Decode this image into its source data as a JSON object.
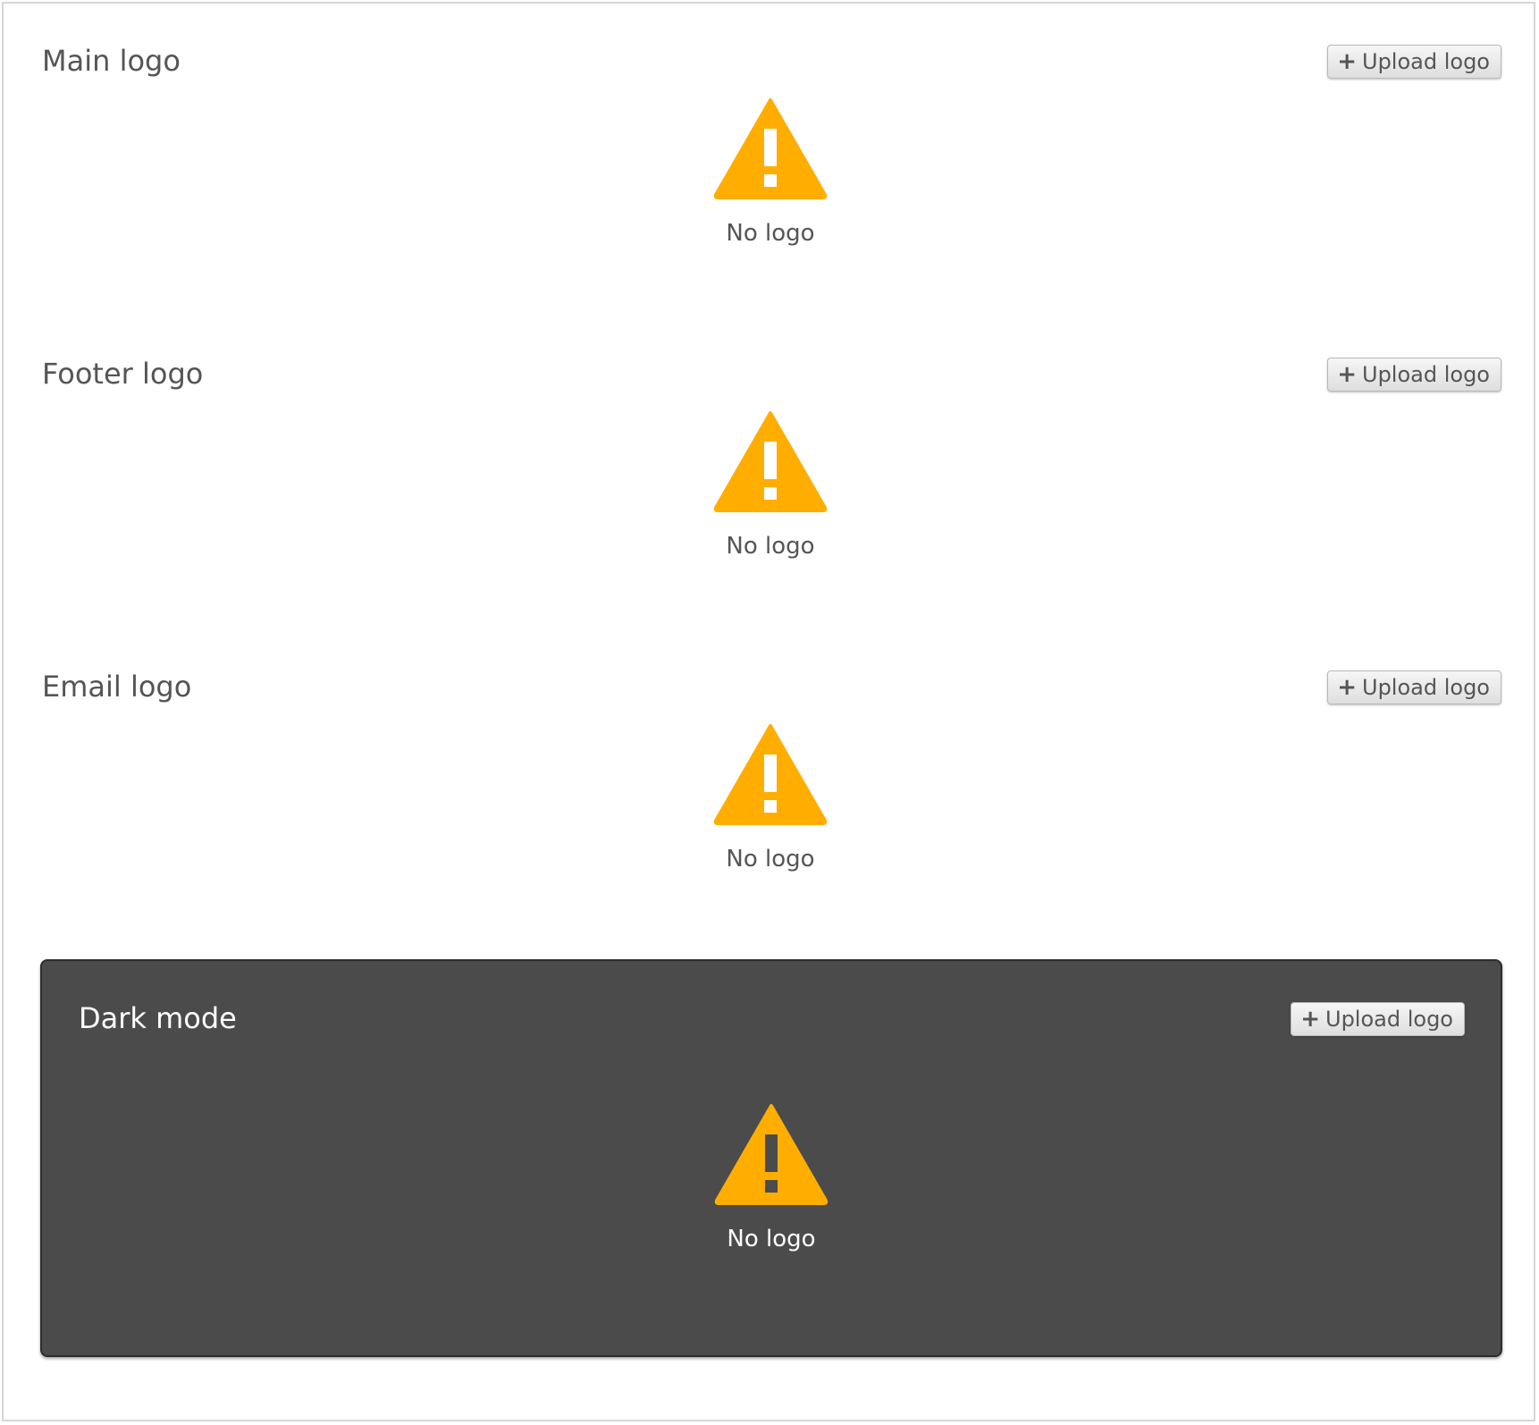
{
  "colors": {
    "warning": "#FFAE00",
    "dark_background": "#4B4B4B",
    "text": "#555555"
  },
  "sections": [
    {
      "title": "Main logo",
      "upload_label": "Upload logo",
      "status": "No logo",
      "icon": "warning-icon"
    },
    {
      "title": "Footer logo",
      "upload_label": "Upload logo",
      "status": "No logo",
      "icon": "warning-icon"
    },
    {
      "title": "Email logo",
      "upload_label": "Upload logo",
      "status": "No logo",
      "icon": "warning-icon"
    }
  ],
  "dark_mode": {
    "title": "Dark mode",
    "upload_label": "Upload logo",
    "status": "No logo",
    "icon": "warning-icon"
  }
}
